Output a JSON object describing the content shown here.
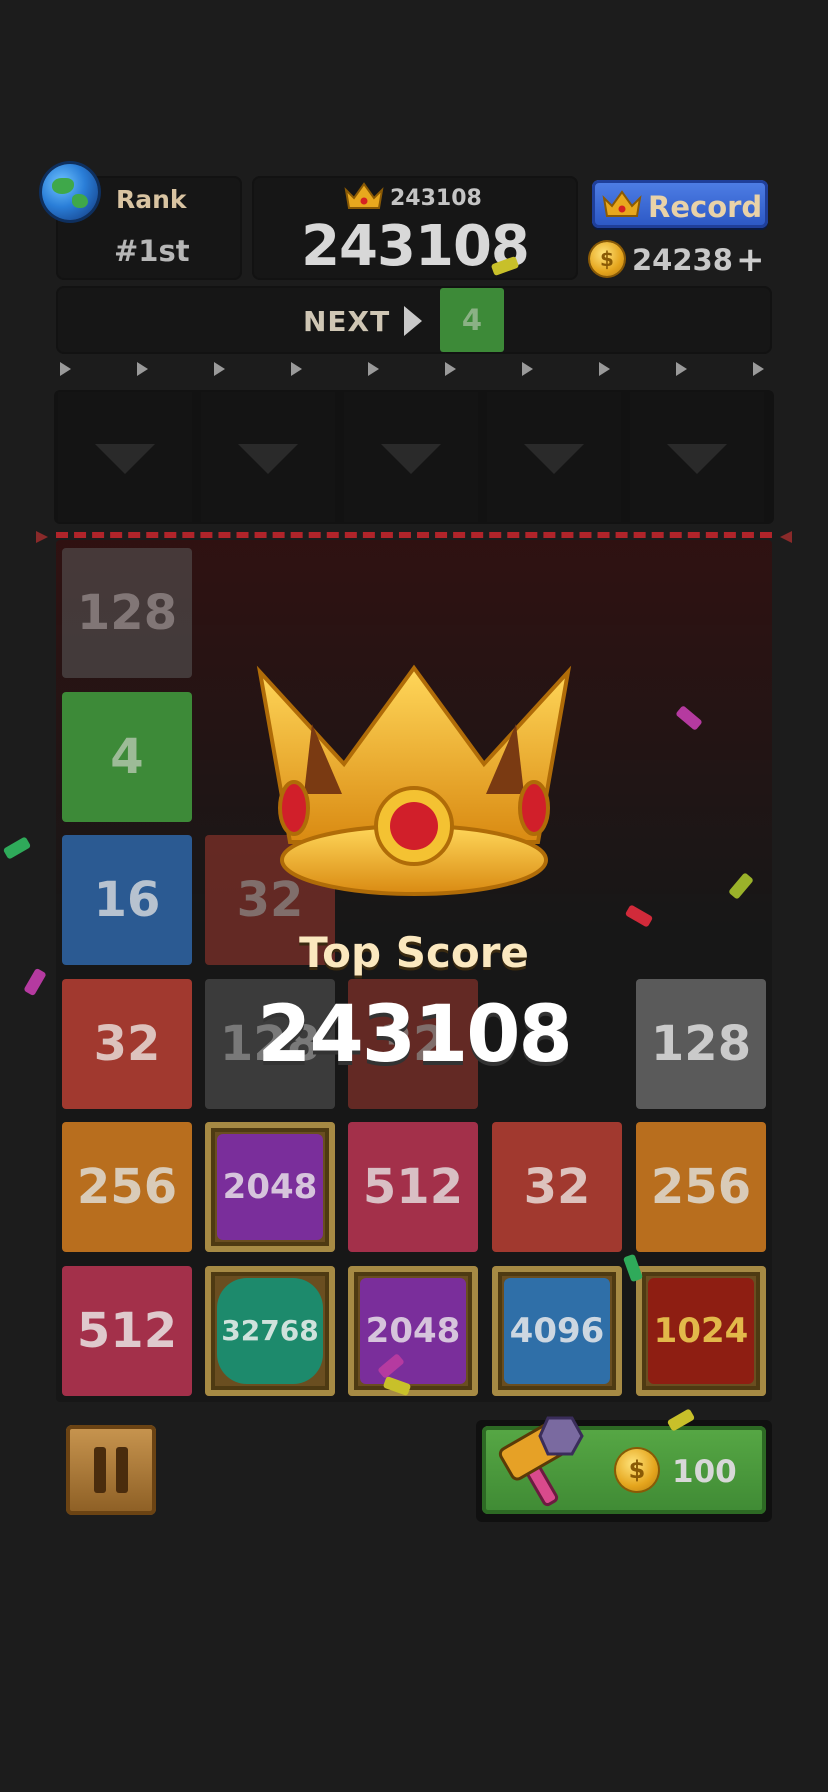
{
  "header": {
    "rank_label": "Rank",
    "rank_value": "#1st",
    "best_score": "243108",
    "score": "243108",
    "record_label": "Record",
    "coins": "24238",
    "plus_label": "+"
  },
  "next": {
    "label": "NEXT",
    "value": "4"
  },
  "board": {
    "rows": [
      [
        "128",
        "",
        "",
        "",
        ""
      ],
      [
        "4",
        "",
        "",
        "",
        ""
      ],
      [
        "16",
        "32",
        "",
        "",
        ""
      ],
      [
        "32",
        "128",
        "32",
        "",
        "128"
      ],
      [
        "256",
        "2048",
        "512",
        "32",
        "256"
      ],
      [
        "512",
        "32768",
        "2048",
        "4096",
        "1024"
      ]
    ]
  },
  "overlay": {
    "title": "Top Score",
    "score": "243108"
  },
  "hammer": {
    "price": "100"
  },
  "colors": {
    "tile_4": "#3d8a38",
    "tile_16": "#2b5a92",
    "tile_32": "#a1392f",
    "tile_128": "#5a5a5a",
    "tile_256": "#b86e1e",
    "tile_512": "#a3304a",
    "tile_2048": "#7a2e9b",
    "tile_4096": "#2f6fa8",
    "tile_1024": "#8e1e12",
    "tile_32768": "#1d8a6c"
  }
}
